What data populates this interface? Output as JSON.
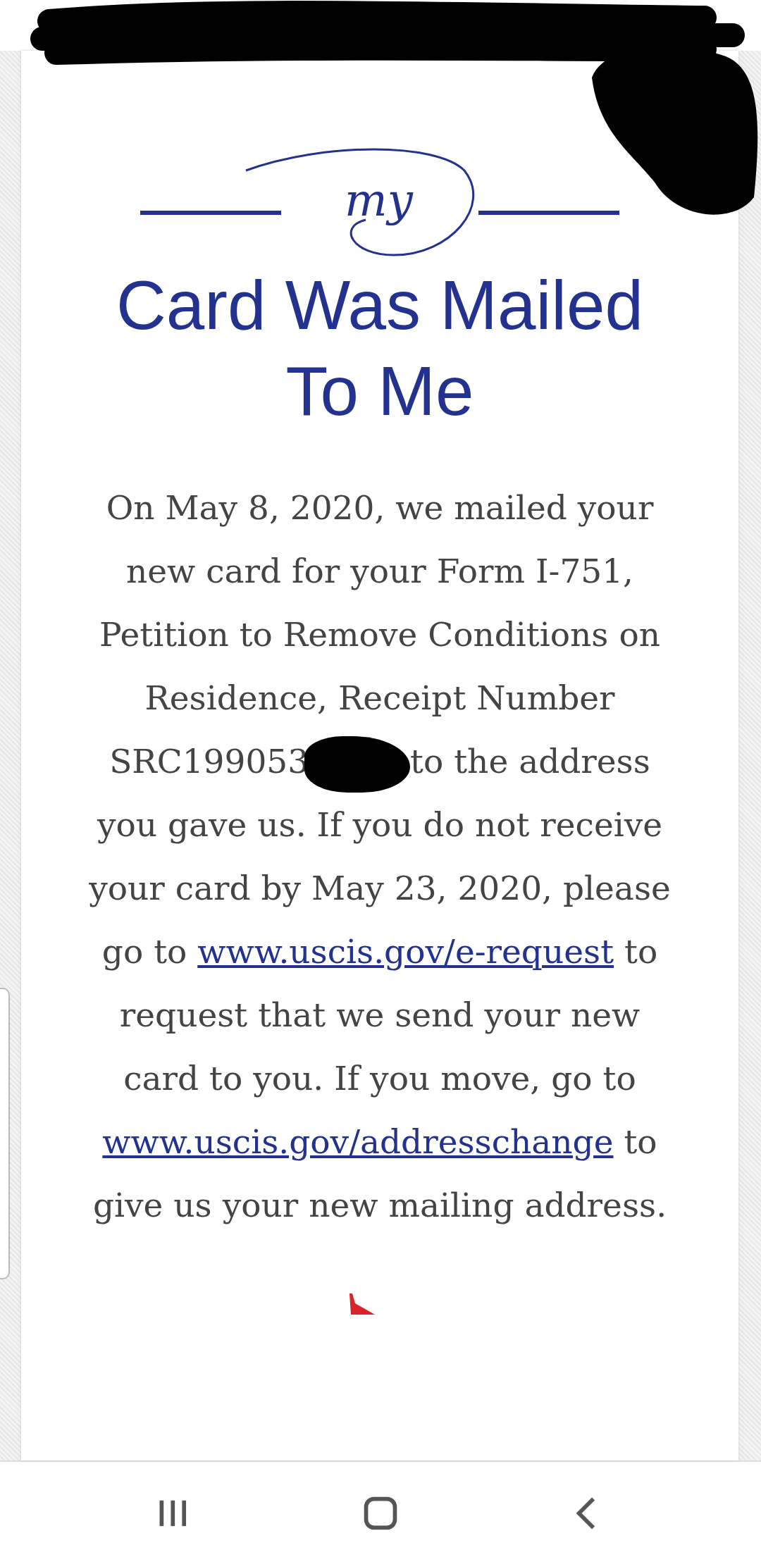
{
  "logo": {
    "text": "my"
  },
  "title": "Card Was Mailed To Me",
  "message": [
    {
      "kind": "text",
      "text": "On May 8, 2020, we mailed your new card for your Form I-751, Petition to Remove Conditions on Residence, Receipt Number SRC199053"
    },
    {
      "kind": "redaction"
    },
    {
      "kind": "text",
      "text": "to the address you gave us. If you do not receive your card by May 23, 2020, please go to "
    },
    {
      "kind": "link",
      "text": "www.uscis.gov/e-request"
    },
    {
      "kind": "text",
      "text": " to request that we send your new card to you. If you move, go to "
    },
    {
      "kind": "link",
      "text": "www.uscis.gov/addresschange"
    },
    {
      "kind": "text",
      "text": " to give us your new mailing address."
    }
  ],
  "nav_bar": [
    {
      "kind": "recents"
    },
    {
      "kind": "home"
    },
    {
      "kind": "back"
    }
  ]
}
